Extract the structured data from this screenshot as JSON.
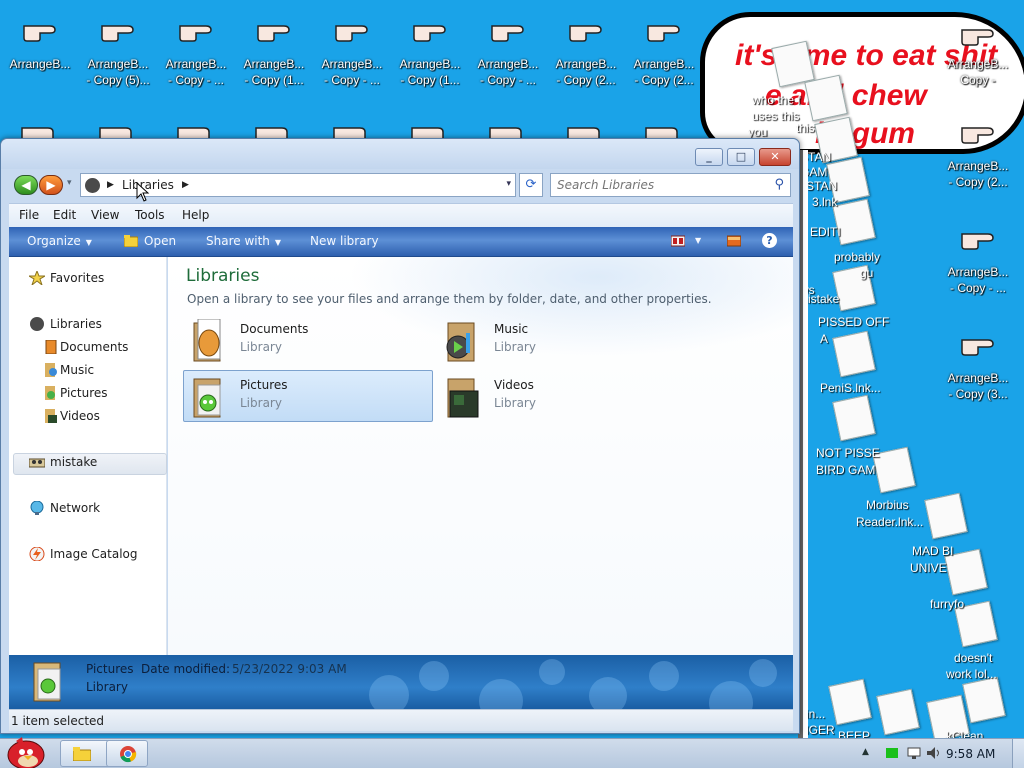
{
  "desktop": {
    "top_icons": [
      {
        "line1": "ArrangeB...",
        "line2": ""
      },
      {
        "line1": "ArrangeB...",
        "line2": "- Copy (5)..."
      },
      {
        "line1": "ArrangeB...",
        "line2": "- Copy - ..."
      },
      {
        "line1": "ArrangeB...",
        "line2": "- Copy (1..."
      },
      {
        "line1": "ArrangeB...",
        "line2": "- Copy - ..."
      },
      {
        "line1": "ArrangeB...",
        "line2": "- Copy (1..."
      },
      {
        "line1": "ArrangeB...",
        "line2": "- Copy - ..."
      },
      {
        "line1": "ArrangeB...",
        "line2": "- Copy (2..."
      },
      {
        "line1": "ArrangeB...",
        "line2": "- Copy (2..."
      }
    ],
    "right_icons": [
      {
        "line1": "ArrangeB...",
        "line2": "Copy -"
      },
      {
        "line1": "ArrangeB...",
        "line2": "- Copy (2..."
      },
      {
        "line1": "ArrangeB...",
        "line2": "- Copy - ..."
      },
      {
        "line1": "ArrangeB...",
        "line2": "- Copy (3..."
      }
    ],
    "meme_lines": [
      "it's time to eat shit",
      "e and chew",
      "bugum"
    ],
    "scattered_labels": [
      "who the f",
      "uses this",
      "this",
      "you",
      "STAN",
      "GAM",
      "STAN",
      "3.lnk",
      "EDITI",
      "probably",
      "gu",
      "ws",
      "mistake",
      "PISSED OFF",
      "A",
      "PeniS.lnk...",
      "NOT PISSE",
      "BIRD GAM",
      "Morbius",
      "Reader.lnk...",
      "MAD BI",
      "UNIVE",
      "furryfo",
      "doesn't",
      "work lol...",
      "BEEP",
      "kClean..",
      "vin...",
      "NGER"
    ],
    "accent_color": "#1aa3e8"
  },
  "window": {
    "address": {
      "crumb": "Libraries",
      "recent_arrow": "▾",
      "dropdown_arrow": "▾"
    },
    "search": {
      "placeholder": "Search Libraries"
    },
    "menu": [
      "File",
      "Edit",
      "View",
      "Tools",
      "Help"
    ],
    "toolbar": {
      "organize": "Organize",
      "open": "Open",
      "share_with": "Share with",
      "new_library": "New library",
      "help": "?"
    },
    "nav": {
      "favorites": "Favorites",
      "libraries": "Libraries",
      "documents": "Documents",
      "music": "Music",
      "pictures": "Pictures",
      "videos": "Videos",
      "mistake": "mistake",
      "network": "Network",
      "image_catalog": "Image Catalog"
    },
    "content": {
      "title": "Libraries",
      "subtitle": "Open a library to see your files and arrange them by folder, date, and other properties.",
      "items": [
        {
          "name": "Documents",
          "type": "Library"
        },
        {
          "name": "Music",
          "type": "Library"
        },
        {
          "name": "Pictures",
          "type": "Library"
        },
        {
          "name": "Videos",
          "type": "Library"
        }
      ]
    },
    "details": {
      "name": "Pictures",
      "modified_label": "Date modified:",
      "modified_value": "5/23/2022 9:03 AM",
      "type": "Library"
    },
    "status": "1 item selected"
  },
  "taskbar": {
    "clock": "9:58 AM",
    "tray_arrow": "▲"
  }
}
